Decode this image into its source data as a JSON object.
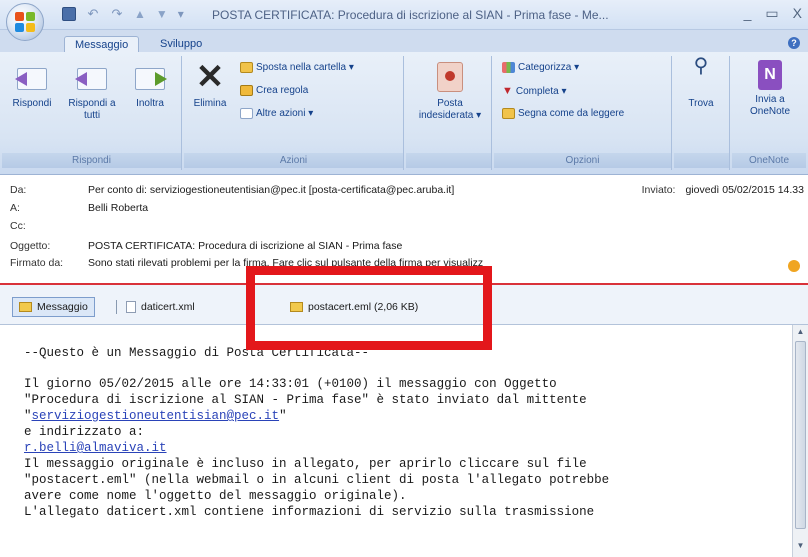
{
  "window": {
    "title": "POSTA CERTIFICATA: Procedura di iscrizione al SIAN - Prima fase - Me...",
    "controls": [
      "_",
      "▭",
      "X"
    ]
  },
  "tabs": [
    {
      "label": "Messaggio"
    },
    {
      "label": "Sviluppo"
    }
  ],
  "ribbon": {
    "rispondi_group": {
      "label": "Rispondi",
      "reply": "Rispondi",
      "reply_all": "Rispondi a tutti",
      "forward": "Inoltra"
    },
    "azioni_group": {
      "label": "Azioni",
      "delete": "Elimina",
      "move": "Sposta nella cartella ▾",
      "rule": "Crea regola",
      "other": "Altre azioni ▾"
    },
    "junk": "Posta indesiderata ▾",
    "opzioni_group": {
      "label": "Opzioni",
      "categorize": "Categorizza ▾",
      "followup": "Completa ▾",
      "mark_read": "Segna come da leggere"
    },
    "find": "Trova",
    "onenote_group": {
      "label": "OneNote",
      "send": "Invia a OneNote"
    }
  },
  "header": {
    "from_label": "Da:",
    "from_value": "Per conto di: serviziogestioneutentisian@pec.it [posta-certificata@pec.aruba.it]",
    "to_label": "A:",
    "to_value": "Belli Roberta",
    "cc_label": "Cc:",
    "subject_label": "Oggetto:",
    "subject_value": "POSTA CERTIFICATA: Procedura di iscrizione al SIAN - Prima fase",
    "signed_label": "Firmato da:",
    "signed_value": "Sono stati rilevati problemi per la firma. Fare clic sul pulsante della firma per visualizz",
    "sent_label": "Inviato:",
    "sent_value": "giovedì 05/02/2015 14.33"
  },
  "attachments": {
    "message_tab": "Messaggio",
    "file1": "daticert.xml",
    "file2": "postacert.eml (2,06 KB)"
  },
  "body": {
    "line1": "--Questo è un Messaggio di Posta Certificata--",
    "line2": "Il giorno 05/02/2015 alle ore 14:33:01 (+0100) il messaggio con Oggetto",
    "line3": "\"Procedura di iscrizione al SIAN - Prima fase\" è stato inviato dal mittente",
    "sender_link": "serviziogestioneutentisian@pec.it",
    "line5": "e indirizzato a:",
    "recipient_link": "r.belli@almaviva.it",
    "line7": "Il messaggio originale è incluso in allegato, per aprirlo cliccare sul file",
    "line8": "\"postacert.eml\" (nella webmail o in alcuni client di posta l'allegato potrebbe",
    "line9": "avere come nome l'oggetto del messaggio originale).",
    "line10": "L'allegato daticert.xml contiene informazioni di servizio sulla trasmissione"
  }
}
